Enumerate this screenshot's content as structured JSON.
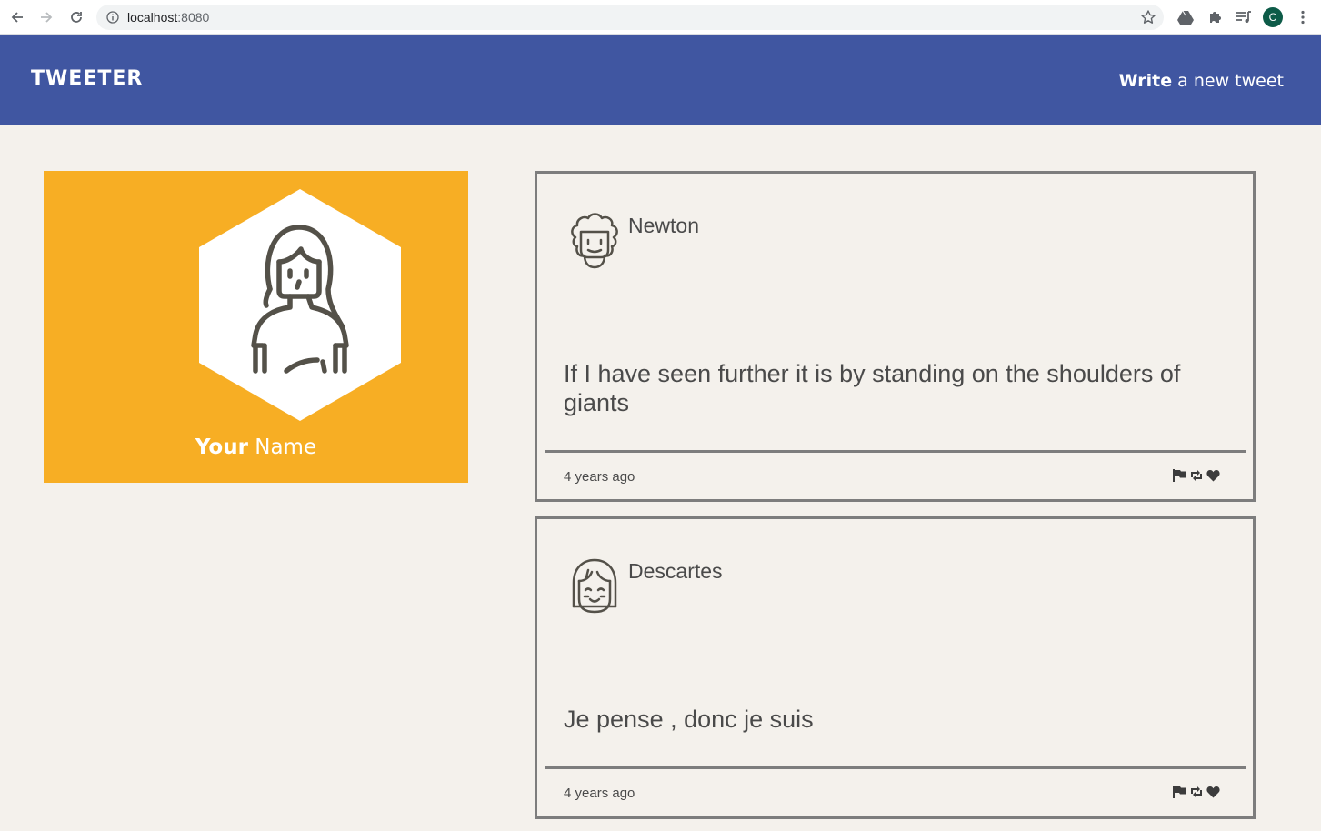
{
  "browser": {
    "url_host": "localhost",
    "url_port": ":8080",
    "profile_initial": "C",
    "profile_color": "#0d5b48"
  },
  "nav": {
    "brand": "TWEETER",
    "compose_bold": "Write",
    "compose_rest": " a new tweet",
    "background": "#4056a1"
  },
  "profile": {
    "name_first": "Your",
    "name_last": " Name",
    "avatar_icon": "woman-avatar-icon",
    "card_color": "#f7ae24"
  },
  "tweets": [
    {
      "author": "Newton",
      "avatar_icon": "curly-hair-avatar-icon",
      "content": "If I have seen further it is by standing on the shoulders of giants",
      "time": "4 years ago"
    },
    {
      "author": "Descartes",
      "avatar_icon": "bob-hair-avatar-icon",
      "content": "Je pense , donc je suis",
      "time": "4 years ago"
    }
  ],
  "actions": {
    "flag_icon": "flag-icon",
    "retweet_icon": "retweet-icon",
    "like_icon": "heart-icon"
  }
}
